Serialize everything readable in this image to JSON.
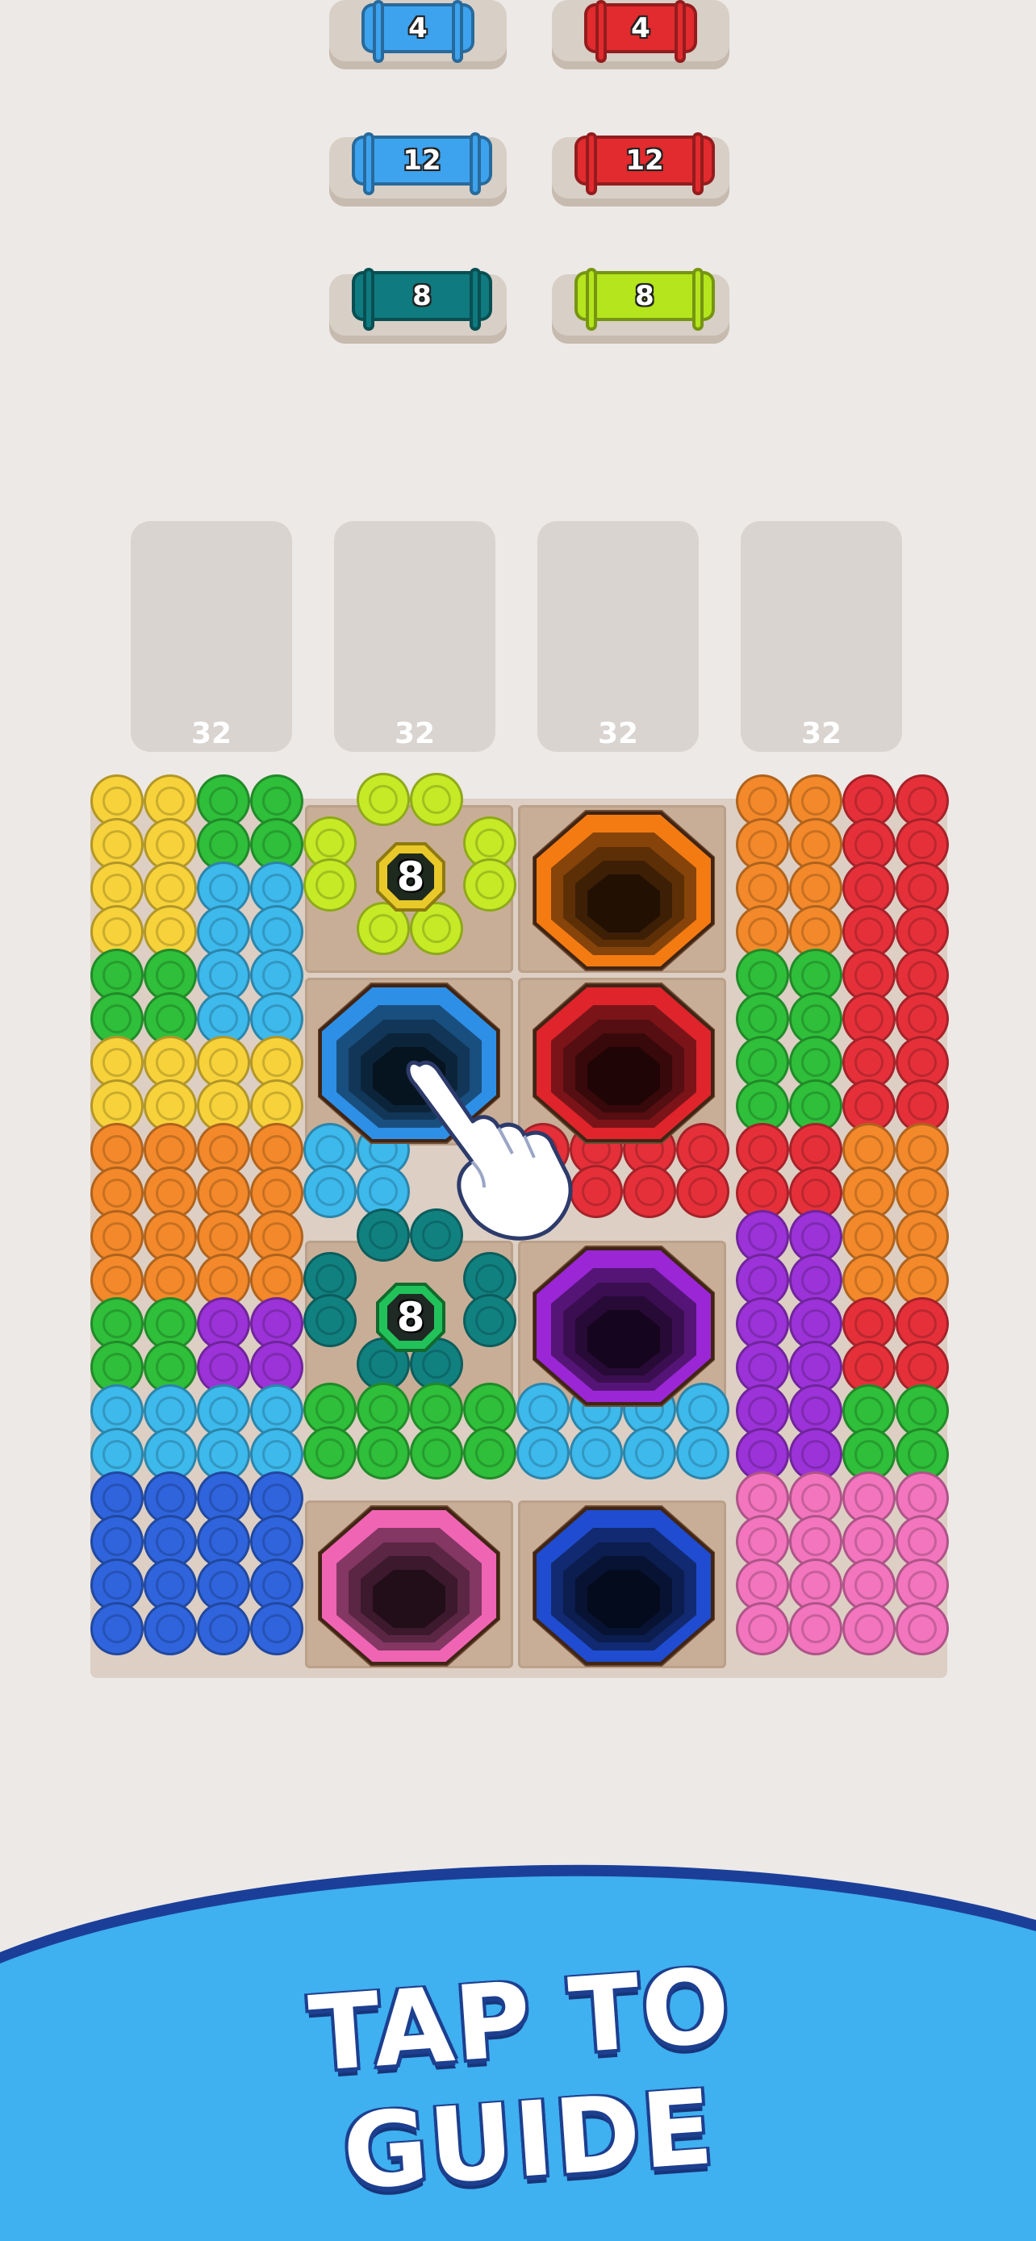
{
  "spool_shelves": [
    {
      "color": "#3ea3ee",
      "count": "4"
    },
    {
      "color": "#e22b2e",
      "count": "4"
    },
    {
      "color": "#3ea3ee",
      "count": "12"
    },
    {
      "color": "#e22b2e",
      "count": "12"
    },
    {
      "color": "#0f7a7f",
      "count": "8"
    },
    {
      "color": "#b5e51d",
      "count": "8"
    }
  ],
  "slots": [
    {
      "capacity": "32"
    },
    {
      "capacity": "32"
    },
    {
      "capacity": "32"
    },
    {
      "capacity": "32"
    }
  ],
  "holes": [
    {
      "name": "orange-hole",
      "color": "#f47b12"
    },
    {
      "name": "blue-hole",
      "color": "#2e8fe6"
    },
    {
      "name": "red-hole",
      "color": "#e0242c"
    },
    {
      "name": "purple-hole",
      "color": "#9a26d6"
    },
    {
      "name": "pink-hole",
      "color": "#f064b4"
    },
    {
      "name": "navy-hole",
      "color": "#1f4cd0"
    }
  ],
  "counters": [
    {
      "value": "8",
      "color": "#b5e51d"
    },
    {
      "value": "8",
      "color": "#138f78"
    }
  ],
  "yarn_colors": {
    "yellow": "#f7d23a",
    "green": "#2fbf3a",
    "sky": "#3db9ec",
    "orange": "#f3892a",
    "red": "#e5303a",
    "lime": "#c6ea26",
    "teal": "#118180",
    "purple": "#9b33d8",
    "blue": "#2f64dd",
    "pink": "#f275bd"
  },
  "banner": {
    "text": "TAP TO GUIDE",
    "color": "#3fb0f0"
  },
  "hand_icon": "pointing-hand-icon"
}
